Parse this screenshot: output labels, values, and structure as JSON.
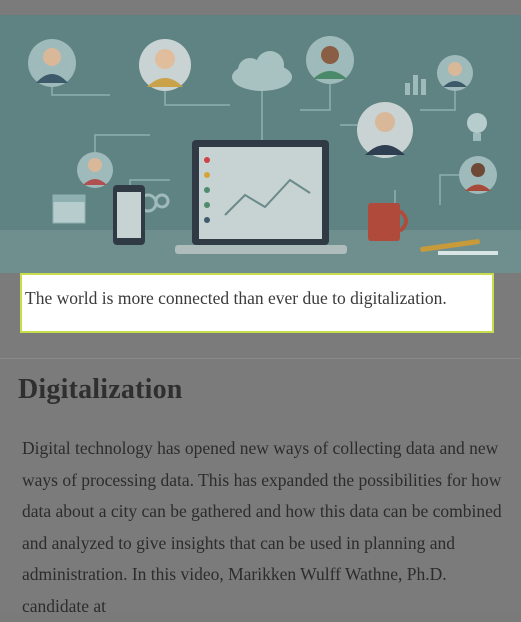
{
  "hero": {
    "icon_names": [
      "person-avatar-icon",
      "cloud-icon",
      "laptop-icon",
      "smartphone-icon",
      "coffee-mug-icon",
      "lightbulb-icon",
      "calendar-icon",
      "gear-icon",
      "bar-chart-icon"
    ]
  },
  "caption": "The world is more connected than ever due to digitalization.",
  "article": {
    "title": "Digitalization",
    "body": "Digital technology has opened new ways of collecting data and new ways of processing data. This has expanded the possibilities for how data about a city can be gathered and how this data can be combined and analyzed to give insights that can be used in planning and administration. In this video, Marikken Wulff Wathne, Ph.D. candidate at"
  },
  "colors": {
    "backdrop": "#7b7b7b",
    "hero_bg": "#5e8282",
    "caption_border": "#c8dd4c",
    "caption_bg": "#ffffff"
  }
}
